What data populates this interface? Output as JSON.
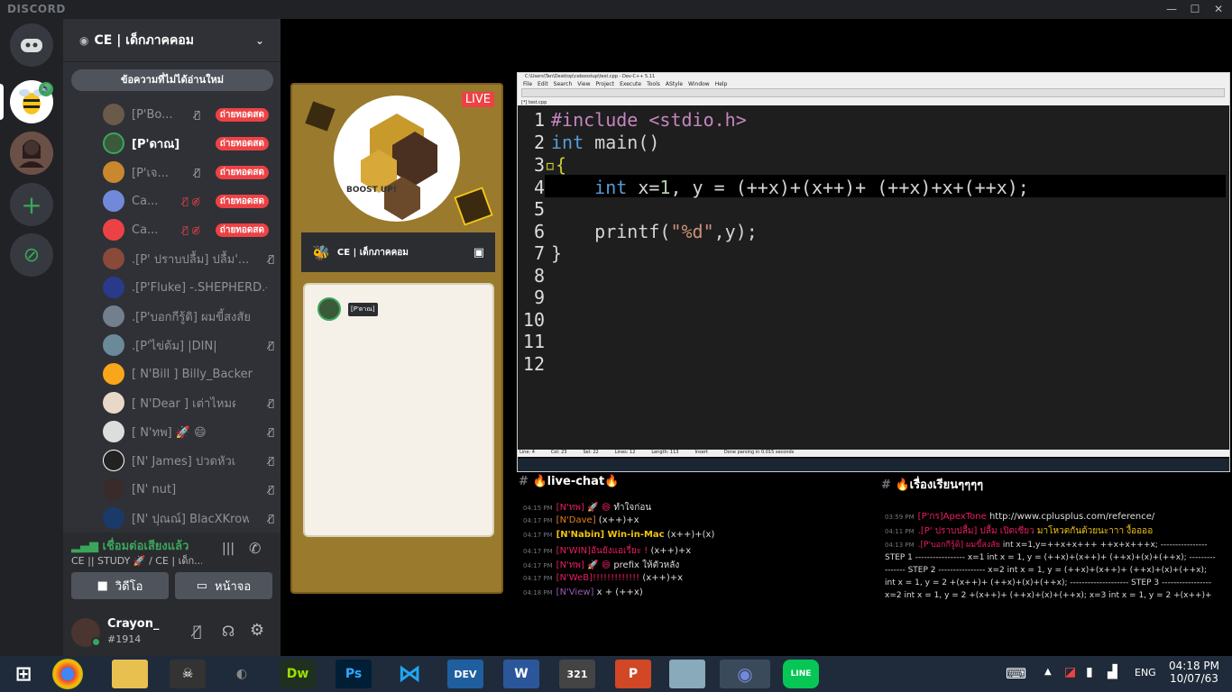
{
  "app": {
    "brand": "DISCORD"
  },
  "server": {
    "name": "CE | เด็กภาคคอม",
    "unread_banner": "ข้อความที่ไม่ได้อ่านใหม่"
  },
  "members": [
    {
      "name": "[P'Bo...",
      "live": "ถ่ายทอดสด",
      "highlight": false
    },
    {
      "name": "[P'ดาณ]",
      "live": "ถ่ายทอดสด",
      "highlight": true
    },
    {
      "name": "[P'เจ...",
      "live": "ถ่ายทอดสด",
      "highlight": false
    },
    {
      "name": "Ca...",
      "live": "ถ่ายทอดสด",
      "highlight": false
    },
    {
      "name": "Ca...",
      "live": "ถ่ายทอดสด",
      "highlight": false
    },
    {
      "name": ".[P' ปราบปลื้ม] ปลื้ม'...",
      "live": "",
      "highlight": false
    },
    {
      "name": ".[P'Fluke] -.SHEPHERD.-",
      "live": "",
      "highlight": false
    },
    {
      "name": ".[P'บอกกีรู้ดิ] ผมขี้สงสัย",
      "live": "",
      "highlight": false
    },
    {
      "name": ".[P'ไข่ต้ม] |DIN|",
      "live": "",
      "highlight": false
    },
    {
      "name": "[ N'Bill ] Billy_Backer",
      "live": "",
      "highlight": false
    },
    {
      "name": "[ N'Dear ] เต่าไหมค...",
      "live": "",
      "highlight": false
    },
    {
      "name": "[ N'ทพ] 🚀 😄",
      "live": "",
      "highlight": false
    },
    {
      "name": "[N' James] ปวดหัวเ...",
      "live": "",
      "highlight": false
    },
    {
      "name": "[N' nut]",
      "live": "",
      "highlight": false
    },
    {
      "name": "[N' ปุณณ์] BlacXKrow",
      "live": "",
      "highlight": false
    }
  ],
  "voice": {
    "status": "เชื่อมต่อเสียงแล้ว",
    "channel": "CE || STUDY 🚀 / CE | เด็ก...",
    "video_label": "วิดีโอ",
    "screen_label": "หน้าจอ"
  },
  "user": {
    "name": "Crayon_",
    "tag": "#1914"
  },
  "stream": {
    "live_badge": "LIVE",
    "logo_text": "BOOST UP!",
    "server_label": "CE | เด็กภาคคอม",
    "participant": "[P'ดาณ]"
  },
  "editor": {
    "title": "C:\\Users\\Tan\\Desktop\\ceboostup\\test.cpp - Dev-C++ 5.11",
    "menu": [
      "File",
      "Edit",
      "Search",
      "View",
      "Project",
      "Execute",
      "Tools",
      "AStyle",
      "Window",
      "Help"
    ],
    "tab": "[*] test.cpp",
    "lines": [
      "1",
      "2",
      "3",
      "4",
      "5",
      "6",
      "7",
      "8",
      "9",
      "10",
      "11",
      "12"
    ],
    "status": {
      "line": "Line: 4",
      "col": "Col: 23",
      "sel": "Sel: 22",
      "lines": "Lines: 12",
      "length": "Length: 113",
      "mode": "Insert",
      "msg": "Done parsing in 0.015 seconds"
    }
  },
  "live_chat": {
    "header": "🔥live-chat🔥",
    "messages": [
      {
        "time": "04:15 PM",
        "user": "[N'ทพ] 🚀 😄",
        "text": "ทำใจก่อน",
        "color": "#e91e63"
      },
      {
        "time": "04:17 PM",
        "user": "[N'Dave]",
        "text": "(x++)+x",
        "color": "#e67e22"
      },
      {
        "time": "04:17 PM",
        "user": "[N'Nabin] Win-in-Mac",
        "text": "(x++)+(x)",
        "color": "#f1c40f"
      },
      {
        "time": "04:17 PM",
        "user": "[N'WIN]อันยังแอเรี่ยะ !",
        "text": "(x++)+x",
        "color": "#e91e63"
      },
      {
        "time": "04:17 PM",
        "user": "[N'ทพ] 🚀 😄",
        "text": "prefix ให้ตัวหลัง",
        "color": "#e91e63"
      },
      {
        "time": "04:17 PM",
        "user": "[N'WeB]!!!!!!!!!!!!!",
        "text": "(x++)+x",
        "color": "#e91e63"
      },
      {
        "time": "04:18 PM",
        "user": "[N'View]",
        "text": "x + (++x)",
        "color": "#9b59b6"
      }
    ]
  },
  "study_chat": {
    "header": "🔥เรื่องเรียนๆๆๆๆ",
    "messages": [
      {
        "time": "03:59 PM",
        "user": "[P'กร]ApexTone",
        "text": "http://www.cplusplus.com/reference/",
        "color": "#e91e63"
      },
      {
        "time": "04:11 PM",
        "user": ".[P' ปราบปลื้ม] ปลื้ม เปิดเซียว",
        "text": "มาโหวตกันด้วยนะาาา งื้ออออ",
        "color": "#e91e63"
      },
      {
        "time": "04:13 PM",
        "user": ".[P'บอกกีรู้ดิ] ผมขี้สงสัย",
        "text": "int x=1,y=++x+x+++ ++x+x+++x; ---------------- STEP 1 ----------------- x=1 int x = 1, y = (++x)+(x++)+ (++x)+(x)+(++x); ---------------- STEP 2 ---------------- x=2 int x = 1, y = (++x)+(x++)+ (++x)+(x)+(++x); int x = 1, y = 2 +(x++)+ (++x)+(x)+(++x); -------------------- STEP 3 ----------------- x=2 int x = 1, y = 2 +(x++)+ (++x)+(x)+(++x); x=3 int x = 1, y = 2 +(x++)+",
        "color": "#e91e63"
      }
    ]
  },
  "taskbar": {
    "lang": "ENG",
    "time": "04:18 PM",
    "date": "10/07/63"
  }
}
